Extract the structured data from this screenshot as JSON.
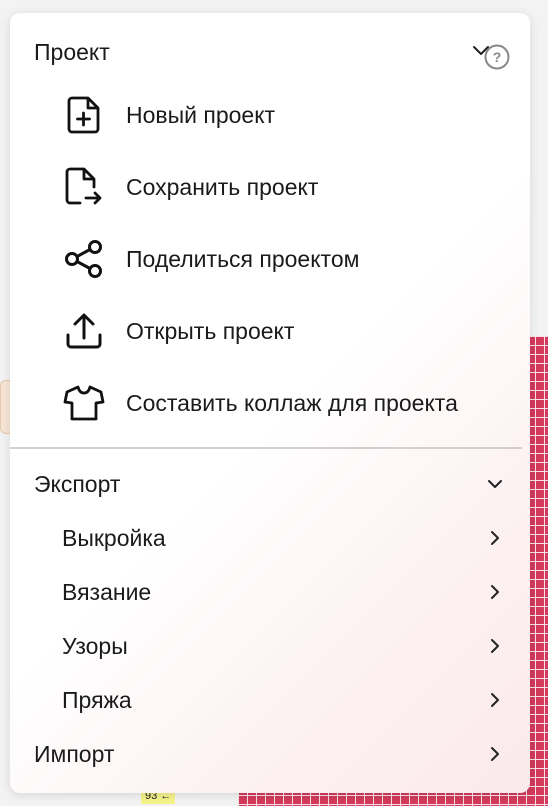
{
  "background": {
    "row_number": "93 ←"
  },
  "menu": {
    "project_section": {
      "title": "Проект",
      "items": [
        {
          "label": "Новый проект",
          "icon": "new-file-icon"
        },
        {
          "label": "Сохранить проект",
          "icon": "save-file-icon"
        },
        {
          "label": "Поделиться проектом",
          "icon": "share-icon"
        },
        {
          "label": "Открыть проект",
          "icon": "upload-icon"
        },
        {
          "label": "Составить коллаж для проекта",
          "icon": "tshirt-icon"
        }
      ]
    },
    "export_section": {
      "title": "Экспорт",
      "items": [
        {
          "label": "Выкройка"
        },
        {
          "label": "Вязание"
        },
        {
          "label": "Узоры"
        },
        {
          "label": "Пряжа"
        }
      ]
    },
    "import_section": {
      "title": "Импорт"
    },
    "colors": {
      "text": "#1b1b1b",
      "divider": "#d0d0d0",
      "grid_red": "#d33a5c",
      "row_label_bg": "#f5f38a"
    }
  }
}
